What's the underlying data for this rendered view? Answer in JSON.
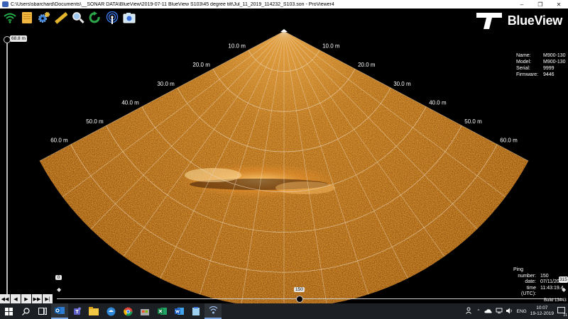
{
  "window": {
    "title": "C:\\Users\\sbarchard\\Documents\\__SONAR DATA\\BlueView\\2019-07-11 BlueView S103\\45 degree tilt\\Jul_11_2019_114232_S103.son - ProViewer4",
    "minimize": "–",
    "maximize": "❐",
    "close": "✕"
  },
  "toolbar": {
    "tools": [
      {
        "name": "wifi-icon",
        "color": "#23b04a"
      },
      {
        "name": "notes-icon",
        "color": "#f0b640"
      },
      {
        "name": "gear-icon",
        "color": "#3b7fd4"
      },
      {
        "name": "ruler-icon",
        "color": "#e3b42c"
      },
      {
        "name": "magnifier-icon",
        "color": "#e8e8e8"
      },
      {
        "name": "refresh-icon",
        "color": "#2ca84a"
      },
      {
        "name": "antenna-icon",
        "color": "#3a6fd8"
      },
      {
        "name": "camera-icon",
        "color": "#8fd0f0"
      }
    ]
  },
  "logo": {
    "text": "BlueView"
  },
  "device_info": {
    "rows": [
      {
        "k": "Name:",
        "v": "M900-130"
      },
      {
        "k": "Model:",
        "v": "M900-130"
      },
      {
        "k": "Serial:",
        "v": "9999"
      },
      {
        "k": "Firmware:",
        "v": "9446"
      }
    ]
  },
  "range": {
    "value": "68.8 m",
    "max_range_m": 68.8
  },
  "range_rings": [
    "10.0 m",
    "20.0 m",
    "30.0 m",
    "40.0 m",
    "50.0 m",
    "60.0 m"
  ],
  "gain": {
    "value": "0"
  },
  "ping": {
    "header": "Ping",
    "rows": [
      {
        "k": "number:",
        "v": "150"
      },
      {
        "k": "date:",
        "v": "07/11/20"
      },
      {
        "k": "time (UTC):",
        "v": "11:43:19.4"
      }
    ],
    "total": "315",
    "current": "150",
    "position": 0.476
  },
  "build": "Build 13443",
  "playback": [
    "◀◀",
    "◀",
    "▶",
    "▶▶",
    "▶|"
  ],
  "taskbar": {
    "items": [
      {
        "name": "windows-start-icon"
      },
      {
        "name": "search-icon"
      },
      {
        "name": "task-view-icon"
      },
      {
        "name": "outlook-icon"
      },
      {
        "name": "teams-icon"
      },
      {
        "name": "file-explorer-icon"
      },
      {
        "name": "edge-icon"
      },
      {
        "name": "chrome-icon"
      },
      {
        "name": "store-icon"
      },
      {
        "name": "excel-icon"
      },
      {
        "name": "word-icon"
      },
      {
        "name": "notepad-icon"
      },
      {
        "name": "proviewer-icon"
      }
    ],
    "lang": "ENG",
    "time": "10:07",
    "date": "19-12-2019",
    "notifications": "21"
  }
}
